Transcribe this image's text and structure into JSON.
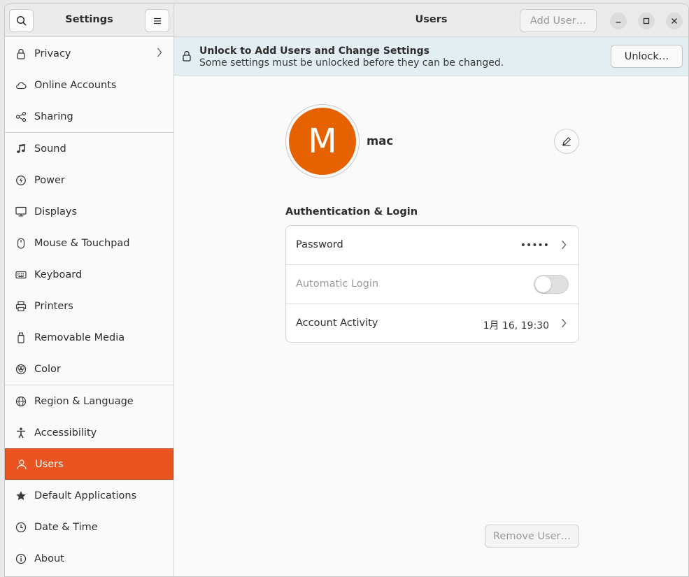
{
  "sidebar": {
    "title": "Settings",
    "search_icon": "search-icon",
    "menu_icon": "hamburger-menu-icon",
    "items": [
      {
        "label": "Privacy",
        "icon": "lock-icon"
      },
      {
        "label": "Online Accounts",
        "icon": "cloud-icon"
      },
      {
        "label": "Sharing",
        "icon": "share-icon"
      },
      {
        "label": "Sound",
        "icon": "music-note-icon"
      },
      {
        "label": "Power",
        "icon": "power-icon"
      },
      {
        "label": "Displays",
        "icon": "display-icon"
      },
      {
        "label": "Mouse & Touchpad",
        "icon": "mouse-icon"
      },
      {
        "label": "Keyboard",
        "icon": "keyboard-icon"
      },
      {
        "label": "Printers",
        "icon": "printer-icon"
      },
      {
        "label": "Removable Media",
        "icon": "removable-media-icon"
      },
      {
        "label": "Color",
        "icon": "color-icon"
      },
      {
        "label": "Region & Language",
        "icon": "globe-icon"
      },
      {
        "label": "Accessibility",
        "icon": "accessibility-icon"
      },
      {
        "label": "Users",
        "icon": "users-icon",
        "active": true
      },
      {
        "label": "Default Applications",
        "icon": "star-icon"
      },
      {
        "label": "Date & Time",
        "icon": "clock-icon"
      },
      {
        "label": "About",
        "icon": "info-icon"
      }
    ]
  },
  "header": {
    "title": "Users",
    "add_user_label": "Add User…"
  },
  "infobar": {
    "title": "Unlock to Add Users and Change Settings",
    "subtitle": "Some settings must be unlocked before they can be changed.",
    "unlock_label": "Unlock…"
  },
  "user": {
    "avatar_initial": "M",
    "name": "mac"
  },
  "auth": {
    "section_title": "Authentication & Login",
    "password_label": "Password",
    "password_value": "•••••",
    "autologin_label": "Automatic Login",
    "autologin_enabled": false,
    "activity_label": "Account Activity",
    "activity_value": "1月 16, 19:30"
  },
  "remove_user_label": "Remove User…",
  "colors": {
    "accent": "#e95420",
    "avatar": "#e66100",
    "infobar": "#e3eef2"
  }
}
